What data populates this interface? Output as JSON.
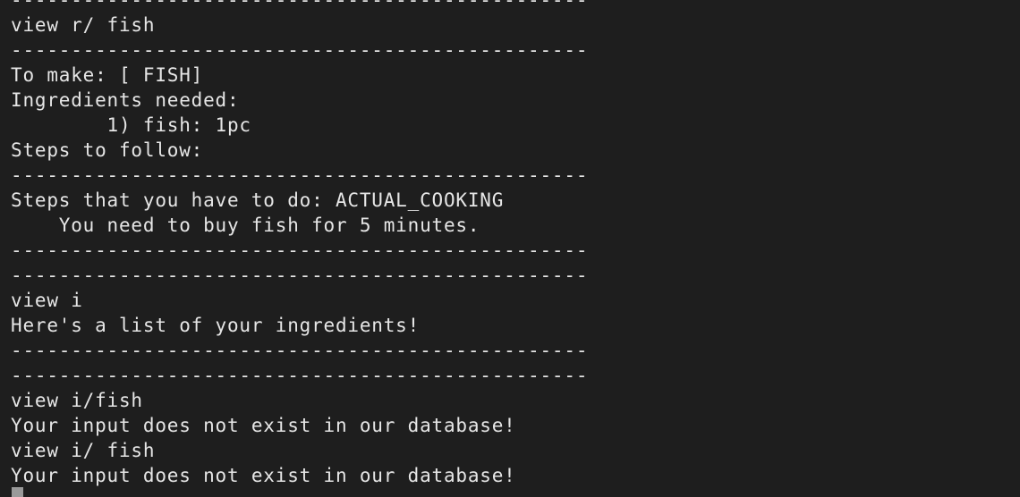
{
  "terminal": {
    "lines": [
      "------------------------------------------------",
      "view r/ fish",
      "------------------------------------------------",
      "To make: [ FISH]",
      "Ingredients needed:",
      "        1) fish: 1pc",
      "Steps to follow:",
      "------------------------------------------------",
      "Steps that you have to do: ACTUAL_COOKING",
      "    You need to buy fish for 5 minutes.",
      "------------------------------------------------",
      "------------------------------------------------",
      "view i",
      "Here's a list of your ingredients!",
      "------------------------------------------------",
      "------------------------------------------------",
      "view i/fish",
      "Your input does not exist in our database!",
      "view i/ fish",
      "Your input does not exist in our database!"
    ]
  }
}
